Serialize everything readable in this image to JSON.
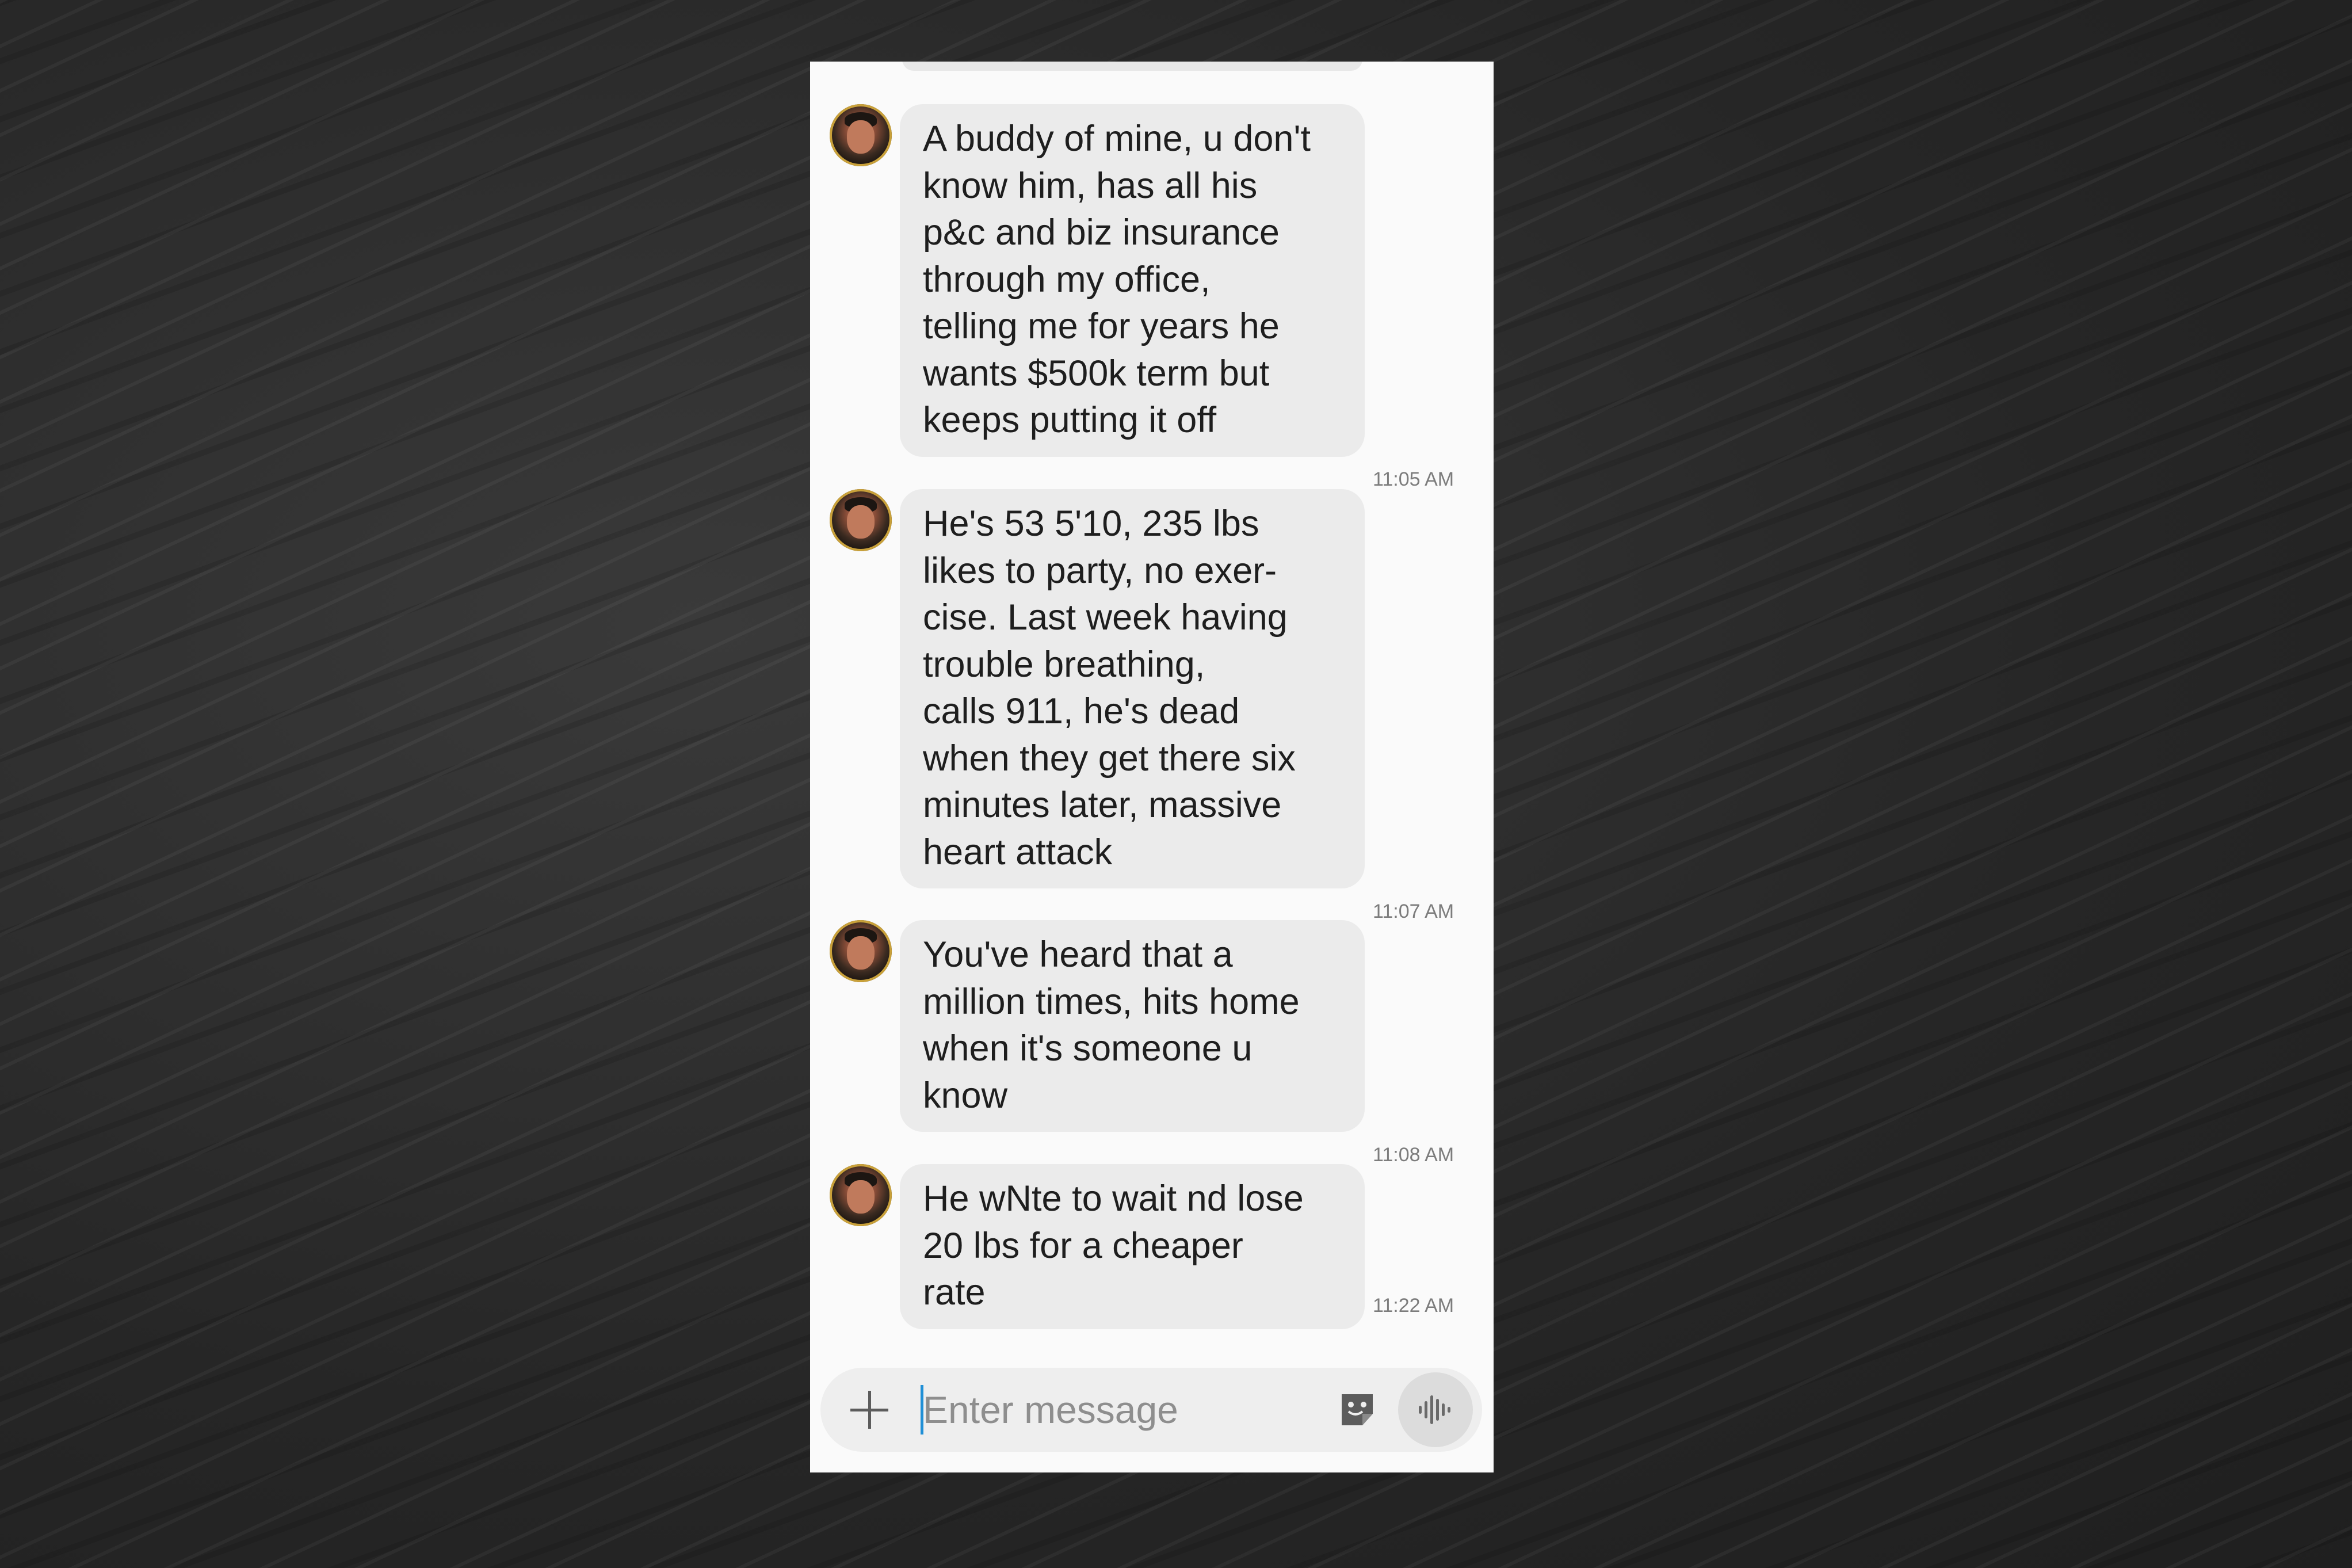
{
  "conversation": {
    "messages": [
      {
        "text": "A buddy of mine, u don't\nknow him, has all his\np&c and biz insurance\nthrough my office,\ntelling me for years he\nwants $500k term but\nkeeps putting it off",
        "time": "11:05 AM"
      },
      {
        "text": "He's 53 5'10, 235 lbs\nlikes to party, no exer-\ncise.  Last week having\ntrouble breathing,\ncalls 911, he's dead\nwhen they get there six\nminutes later, massive\nheart attack",
        "time": "11:07 AM"
      },
      {
        "text": "You've heard that a\nmillion times, hits home\nwhen it's someone u\nknow",
        "time": "11:08 AM"
      },
      {
        "text": "He wNte to wait nd lose\n20 lbs for a cheaper\nrate",
        "time": "11:22 AM"
      }
    ]
  },
  "composer": {
    "placeholder": "Enter message",
    "icons": {
      "add": "plus-icon",
      "sticker": "sticker-icon",
      "voice": "voice-wave-icon"
    }
  },
  "colors": {
    "bubble": "#ebebeb",
    "screen": "#fafafa",
    "cursor": "#1f8fd6",
    "timestamp": "#7c7c7c"
  }
}
